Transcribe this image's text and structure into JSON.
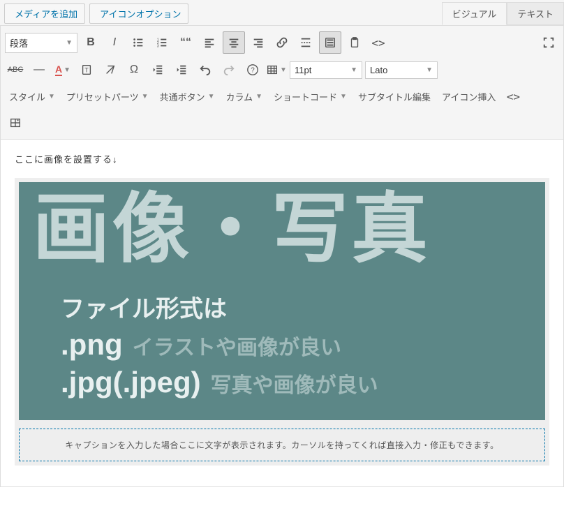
{
  "top": {
    "add_media": "メディアを追加",
    "icon_options": "アイコンオプション"
  },
  "tabs": {
    "visual": "ビジュアル",
    "text": "テキスト"
  },
  "toolbar": {
    "paragraph": "段落",
    "font_size": "11pt",
    "font_family": "Lato"
  },
  "toolbar3": {
    "style": "スタイル",
    "preset": "プリセットパーツ",
    "common_btn": "共通ボタン",
    "column": "カラム",
    "shortcode": "ショートコード",
    "subtitle": "サブタイトル編集",
    "icon_insert": "アイコン挿入"
  },
  "editor": {
    "instruction": "ここに画像を設置する↓",
    "img_title": "画像・写真",
    "img_sub1": "ファイル形式は",
    "fmt_png": ".png",
    "desc_png": "イラストや画像が良い",
    "fmt_jpg": ".jpg(.jpeg)",
    "desc_jpg": "写真や画像が良い",
    "caption": "キャプションを入力した場合ここに文字が表示されます。カーソルを持ってくれば直接入力・修正もできます。"
  }
}
